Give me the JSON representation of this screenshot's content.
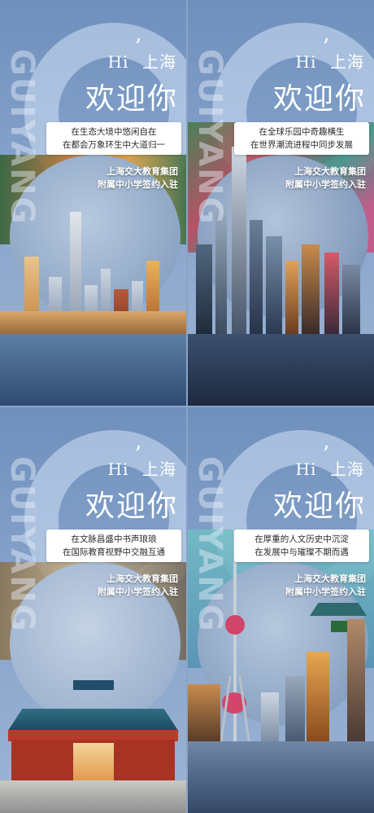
{
  "posters": [
    {
      "vertical_text": "GUIYANG",
      "hi": "Hi",
      "apostrophe": "’",
      "city": "上海",
      "title": "欢迎你",
      "lines": [
        "在生态大境中悠闲自在",
        "在都会万象环生中大道归一"
      ],
      "org": [
        "上海交大教育集团",
        "附属中小学签约入驻"
      ],
      "theme": "skyline-autumn"
    },
    {
      "vertical_text": "GUIYANG",
      "hi": "Hi",
      "apostrophe": "’",
      "city": "上海",
      "title": "欢迎你",
      "lines": [
        "在全球乐园中奇趣横生",
        "在世界潮流进程中同步发展"
      ],
      "org": [
        "上海交大教育集团",
        "附属中小学签约入驻"
      ],
      "theme": "skyline-night"
    },
    {
      "vertical_text": "GUIYANG",
      "hi": "Hi",
      "apostrophe": "’",
      "city": "上海",
      "title": "欢迎你",
      "lines": [
        "在文脉昌盛中书声琅琅",
        "在国际教育视野中交融互通"
      ],
      "org": [
        "上海交大教育集团",
        "附属中小学签约入驻"
      ],
      "theme": "campus-gate"
    },
    {
      "vertical_text": "GUIYANG",
      "hi": "Hi",
      "apostrophe": "’",
      "city": "上海",
      "title": "欢迎你",
      "lines": [
        "在厚重的人文历史中沉淀",
        "在发展中与璀璨不期而遇"
      ],
      "org": [
        "上海交大教育集团",
        "附属中小学签约入驻"
      ],
      "theme": "pearl-tower"
    }
  ],
  "colors": {
    "sky": "#7f9cc4",
    "text": "#ffffff",
    "accent_pink": "#d2456b"
  }
}
